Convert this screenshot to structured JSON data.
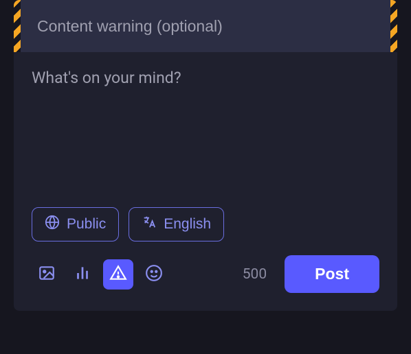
{
  "compose": {
    "content_warning": {
      "placeholder": "Content warning (optional)",
      "value": ""
    },
    "body": {
      "placeholder": "What's on your mind?",
      "value": ""
    },
    "visibility": {
      "label": "Public",
      "icon": "globe-icon"
    },
    "language": {
      "label": "English",
      "icon": "translate-icon"
    },
    "char_count": "500",
    "post_button": "Post",
    "toolbar": {
      "media": "media-icon",
      "poll": "poll-icon",
      "cw": "warning-icon",
      "emoji": "emoji-icon",
      "cw_active": true
    }
  }
}
